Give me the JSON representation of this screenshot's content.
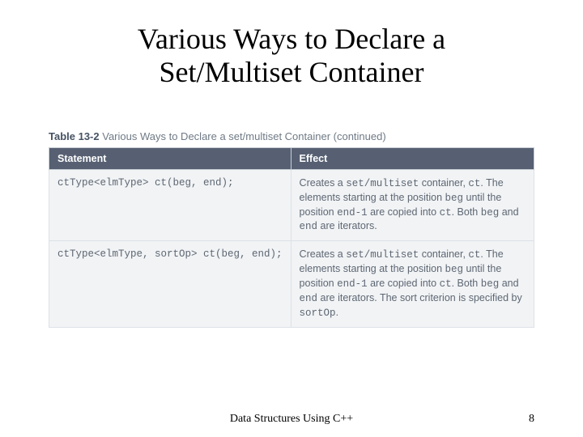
{
  "title": "Various Ways to Declare a Set/Multiset Container",
  "table": {
    "label": "Table 13-2",
    "caption_rest": "Various Ways to Declare a set/multiset Container (continued)",
    "head": {
      "col1": "Statement",
      "col2": "Effect"
    },
    "rows": [
      {
        "stmt": "ctType<elmType> ct(beg, end);",
        "effect_parts": {
          "p1": "Creates a ",
          "m1": "set/multiset",
          "p2": " container, ",
          "m2": "ct",
          "p3": ". The elements starting at the position ",
          "m3": "beg",
          "p4": " until the position ",
          "m4": "end-1",
          "p5": " are copied into ",
          "m5": "ct",
          "p6": ". Both ",
          "m6": "beg",
          "p7": " and ",
          "m7": "end",
          "p8": " are iterators."
        }
      },
      {
        "stmt": "ctType<elmType, sortOp> ct(beg, end);",
        "effect_parts": {
          "p1": "Creates a ",
          "m1": "set/multiset",
          "p2": " container, ",
          "m2": "ct",
          "p3": ". The elements starting at the position ",
          "m3": "beg",
          "p4": " until the position ",
          "m4": "end-1",
          "p5": " are copied into ",
          "m5": "ct",
          "p6": ". Both ",
          "m6": "beg",
          "p7": " and ",
          "m7": "end",
          "p8": " are iterators. The sort criterion is specified by ",
          "m8": "sortOp",
          "p9": "."
        }
      }
    ]
  },
  "footer": {
    "center": "Data Structures Using C++",
    "page": "8"
  }
}
